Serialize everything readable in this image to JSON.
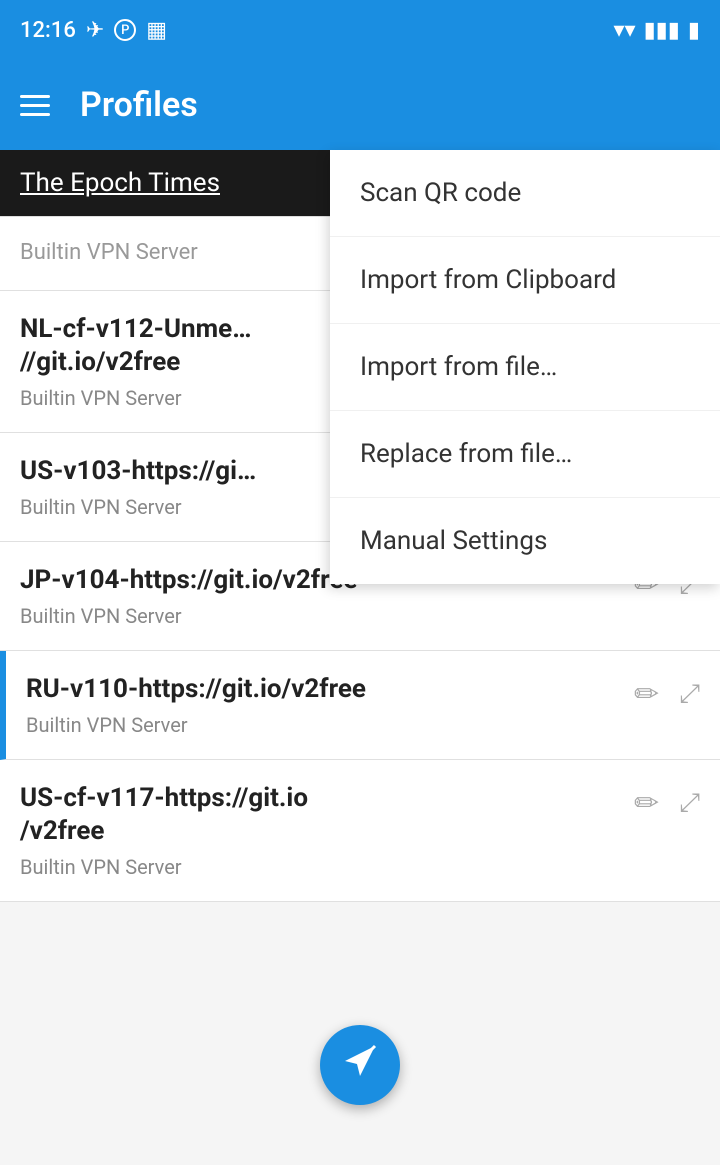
{
  "statusBar": {
    "time": "12:16",
    "icons": [
      "location-arrow-icon",
      "p-icon",
      "sim-icon",
      "wifi-icon",
      "signal-icon",
      "battery-icon"
    ]
  },
  "appBar": {
    "title": "Profiles",
    "menuIcon": "hamburger-icon"
  },
  "epochBanner": {
    "text": "The Epoch Times"
  },
  "profiles": [
    {
      "id": "1",
      "title": "Builtin VPN Server",
      "subtitle": "",
      "partial": true,
      "truncatedTitle": "Builtin VPN Server",
      "active": false,
      "showActions": false
    },
    {
      "id": "2",
      "title": "NL-cf-v112-Unme…//git.io/v2free",
      "subtitle": "Builtin VPN Server",
      "partial": true,
      "active": false,
      "showActions": false
    },
    {
      "id": "3",
      "title": "US-v103-https://gi…",
      "subtitle": "Builtin VPN Server",
      "partial": true,
      "active": false,
      "showActions": false
    },
    {
      "id": "4",
      "title": "JP-v104-https://git.io/v2free",
      "subtitle": "Builtin VPN Server",
      "partial": false,
      "active": false,
      "showActions": true
    },
    {
      "id": "5",
      "title": "RU-v110-https://git.io/v2free",
      "subtitle": "Builtin VPN Server",
      "partial": false,
      "active": true,
      "showActions": true
    },
    {
      "id": "6",
      "title": "US-cf-v117-https://git.io/v2free",
      "subtitle": "Builtin VPN Server",
      "partial": false,
      "active": false,
      "showActions": true
    }
  ],
  "dropdown": {
    "items": [
      {
        "id": "scan-qr",
        "label": "Scan QR code"
      },
      {
        "id": "import-clipboard",
        "label": "Import from Clipboard"
      },
      {
        "id": "import-file",
        "label": "Import from file…"
      },
      {
        "id": "replace-file",
        "label": "Replace from file…"
      },
      {
        "id": "manual-settings",
        "label": "Manual Settings"
      }
    ]
  },
  "fab": {
    "icon": "send-icon",
    "label": "▶"
  }
}
